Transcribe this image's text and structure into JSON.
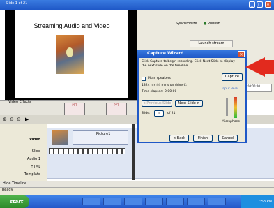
{
  "window": {
    "title": "Slide 1 of 21",
    "minimize": "_",
    "maximize": "□",
    "close": "✕"
  },
  "slide": {
    "title": "Streaming Audio and Video"
  },
  "toolbar": {
    "synchronize": "Synchronize",
    "publish": "Publish"
  },
  "right_panel": {
    "tab": "Launch stream",
    "time": "0:00:00:00"
  },
  "effects": {
    "label": "Video Effects",
    "thumb_label": "PPT"
  },
  "timeline": {
    "labels": [
      "Video",
      "Slide",
      "Audio 1",
      "HTML",
      "Template"
    ],
    "clip_label": "Picture1",
    "hide_timeline": "Hide Timeline"
  },
  "status": {
    "text": "Ready"
  },
  "taskbar": {
    "start": "start",
    "tray_time": "7:53 PM"
  },
  "dialog": {
    "title": "Capture Wizard",
    "instructions": "Click Capture to begin recording. Click Next Slide to display the next slide on the timeline.",
    "mute_label": "Mute speakers",
    "space_info": "1324 hrs 44 mins on drive C:",
    "time_elapsed": "Time elapsed: 0:00:00",
    "input_level": "Input level",
    "capture_btn": "Capture",
    "prev_btn": "< Previous Slide",
    "next_btn": "Next Slide >",
    "slide_label": "Slide:",
    "slide_value": "1",
    "slide_total": "of 21",
    "microphone": "Microphone",
    "back_btn": "< Back",
    "finish_btn": "Finish",
    "cancel_btn": "Cancel"
  },
  "annotation": {
    "arrow_color": "#e22a1e"
  }
}
